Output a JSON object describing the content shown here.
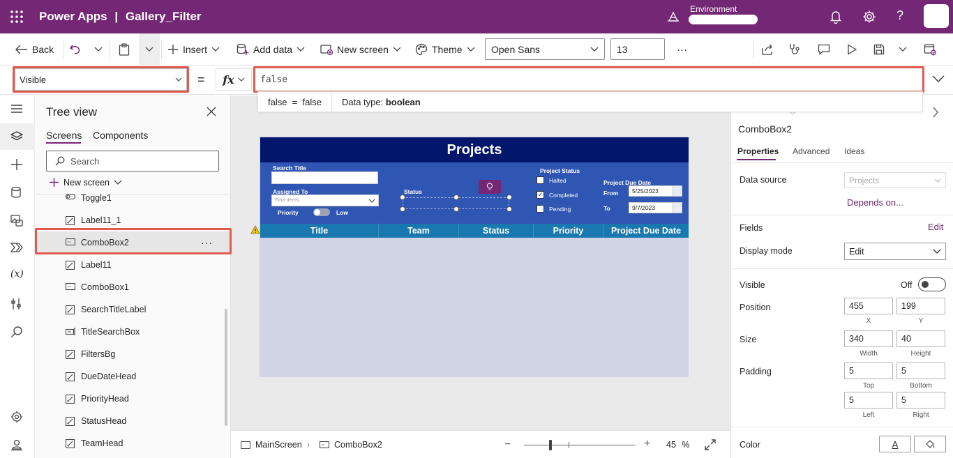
{
  "titlebar": {
    "app_name": "Power Apps",
    "separator": "|",
    "document_name": "Gallery_Filter",
    "environment_label": "Environment",
    "color": "#742774"
  },
  "toolbar": {
    "back": "Back",
    "insert": "Insert",
    "add_data": "Add data",
    "new_screen": "New screen",
    "theme": "Theme",
    "font": "Open Sans",
    "font_size": "13",
    "more": "···"
  },
  "formula": {
    "property": "Visible",
    "equals": "=",
    "fx": "fx",
    "value": "false",
    "hint_expression": "false  =  false",
    "hint_type_label": "Data type: ",
    "hint_type_value": "boolean"
  },
  "tree": {
    "title": "Tree view",
    "tabs": [
      "Screens",
      "Components"
    ],
    "search_placeholder": "Search",
    "new_screen": "New screen",
    "items": [
      {
        "label": "Toggle1",
        "icon": "toggle-icon"
      },
      {
        "label": "Label11_1",
        "icon": "label-icon"
      },
      {
        "label": "ComboBox2",
        "icon": "combobox-icon",
        "selected": true,
        "more": "···"
      },
      {
        "label": "Label11",
        "icon": "label-icon"
      },
      {
        "label": "ComboBox1",
        "icon": "combobox-icon"
      },
      {
        "label": "SearchTitleLabel",
        "icon": "label-icon"
      },
      {
        "label": "TitleSearchBox",
        "icon": "textinput-icon"
      },
      {
        "label": "FiltersBg",
        "icon": "label-icon"
      },
      {
        "label": "DueDateHead",
        "icon": "label-icon"
      },
      {
        "label": "PriorityHead",
        "icon": "label-icon"
      },
      {
        "label": "StatusHead",
        "icon": "label-icon"
      },
      {
        "label": "TeamHead",
        "icon": "label-icon"
      }
    ]
  },
  "app": {
    "title": "Projects",
    "search_title": "Search Title",
    "assigned_to": "Assigned To",
    "find_items": "Find items",
    "priority": "Priority",
    "low": "Low",
    "status": "Status",
    "project_status": "Project Status",
    "status_options": [
      {
        "label": "Halted",
        "checked": false
      },
      {
        "label": "Completed",
        "checked": true
      },
      {
        "label": "Pending",
        "checked": false
      }
    ],
    "due_date_title": "Project Due Date",
    "from_label": "From",
    "from_date": "5/25/2023",
    "to_label": "To",
    "to_date": "9/7/2023",
    "columns": [
      "Title",
      "Team",
      "Status",
      "Priority",
      "Project Due Date"
    ],
    "colors": {
      "header": "#02166b",
      "filters": "#3056b3",
      "columns": "#1a78b0",
      "body": "#d1d4e4"
    }
  },
  "bottom": {
    "screen": "MainScreen",
    "control": "ComboBox2",
    "zoom": "45",
    "zoom_unit": "%",
    "zoom_slider_fraction": 0.24
  },
  "props": {
    "control_name": "ComboBox2",
    "tabs": [
      "Properties",
      "Advanced",
      "Ideas"
    ],
    "data_source_label": "Data source",
    "data_source_value": "Projects",
    "depends_on": "Depends on...",
    "fields_label": "Fields",
    "fields_edit": "Edit",
    "display_mode_label": "Display mode",
    "display_mode_value": "Edit",
    "visible_label": "Visible",
    "visible_state": "Off",
    "position_label": "Position",
    "position_x": "455",
    "position_y": "199",
    "x_label": "X",
    "y_label": "Y",
    "size_label": "Size",
    "width": "340",
    "height": "40",
    "width_label": "Width",
    "height_label": "Height",
    "padding_label": "Padding",
    "pad_top": "5",
    "pad_bottom": "5",
    "pad_left": "5",
    "pad_right": "5",
    "top_label": "Top",
    "bottom_label": "Bottom",
    "left_label": "Left",
    "right_label": "Right",
    "color_label": "Color",
    "color_letter": "A"
  }
}
